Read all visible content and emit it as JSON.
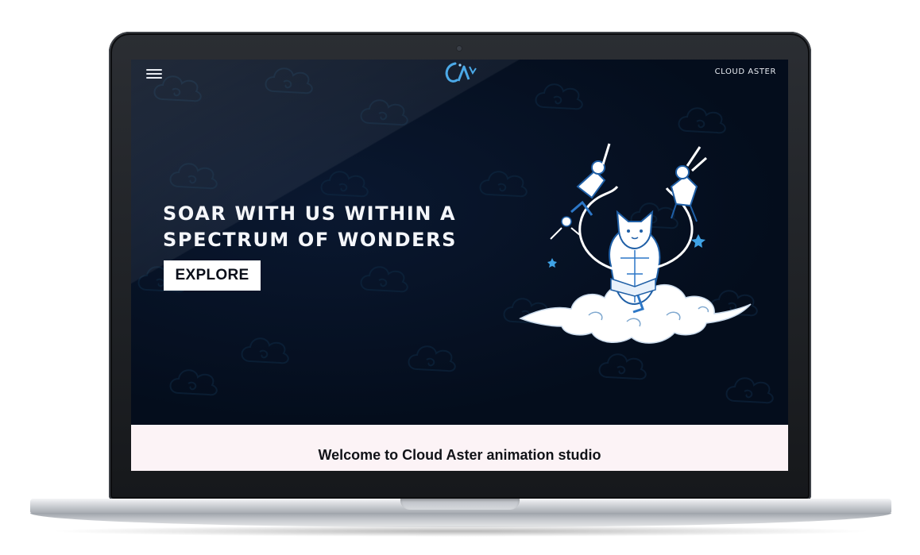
{
  "nav": {
    "menu_icon": "hamburger-menu-icon",
    "logo_icon": "cloud-aster-logo-icon",
    "brand_name": "CLOUD ASTER"
  },
  "hero": {
    "headline": "SOAR WITH US WITHIN A SPECTRUM OF WONDERS",
    "cta_label": "EXPLORE",
    "illustration": "cat-on-cloud-illustration"
  },
  "welcome": {
    "title": "Welcome to Cloud Aster animation studio"
  },
  "colors": {
    "hero_background": "#040d1c",
    "accent_blue": "#3fa3e6",
    "welcome_background": "#fcf3f6",
    "button_background": "#ffffff"
  }
}
